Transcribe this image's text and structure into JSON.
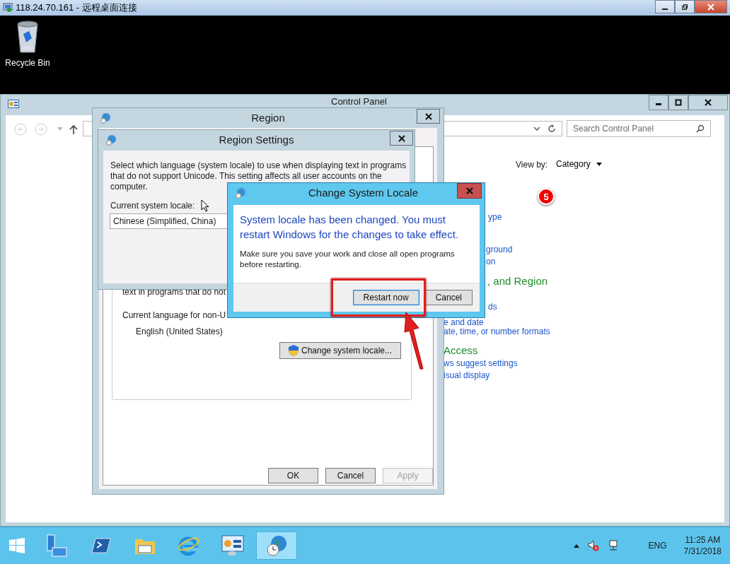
{
  "rdp_window": {
    "title": "118.24.70.161 - 远程桌面连接"
  },
  "desktop": {
    "icons": [
      {
        "label": "Recycle Bin"
      }
    ]
  },
  "control_panel": {
    "title": "Control Panel",
    "search": {
      "placeholder": "Search Control Panel"
    },
    "view_by": {
      "label": "View by:",
      "value": "Category"
    },
    "badge": "5",
    "items": [
      {
        "kind": "link",
        "text": "ype"
      },
      {
        "kind": "link",
        "text": "ground"
      },
      {
        "kind": "link",
        "text": "on"
      },
      {
        "kind": "heading",
        "text": ", and Region"
      },
      {
        "kind": "link",
        "text": "ds"
      },
      {
        "kind": "link",
        "text": "e and date"
      },
      {
        "kind": "link",
        "text": "ate, time, or number formats"
      },
      {
        "kind": "heading",
        "text": "Access"
      },
      {
        "kind": "link",
        "text": "ws suggest settings"
      },
      {
        "kind": "link",
        "text": "isual display"
      }
    ]
  },
  "region_dialog": {
    "title": "Region",
    "partial_line": "text in programs that do not",
    "language_label": "Current language for non-U",
    "language_value": "English (United States)",
    "change_button": "Change system locale...",
    "buttons": [
      {
        "label": "OK",
        "disabled": false
      },
      {
        "label": "Cancel",
        "disabled": false
      },
      {
        "label": "Apply",
        "disabled": true
      }
    ]
  },
  "region_settings": {
    "title": "Region Settings",
    "description": "Select which language (system locale) to use when displaying text in programs that do not support Unicode. This setting affects all user accounts on the computer.",
    "locale_label": "Current system locale:",
    "locale_value": "Chinese (Simplified, China)"
  },
  "change_locale_dialog": {
    "title": "Change System Locale",
    "message": "System locale has been changed. You must restart Windows for the changes to take effect.",
    "note": "Make sure you save your work and close all open programs before restarting.",
    "buttons": [
      {
        "label": "Restart now",
        "selected": true
      },
      {
        "label": "Cancel",
        "selected": false
      }
    ]
  },
  "taskbar": {
    "apps": [
      {
        "kind": "server-manager",
        "selected": false
      },
      {
        "kind": "powershell",
        "selected": false
      },
      {
        "kind": "explorer",
        "selected": false
      },
      {
        "kind": "ie",
        "selected": false
      },
      {
        "kind": "control-panel",
        "selected": false
      },
      {
        "kind": "region",
        "selected": true
      }
    ],
    "language": "ENG",
    "time": "11:25 AM",
    "date": "7/31/2018"
  }
}
